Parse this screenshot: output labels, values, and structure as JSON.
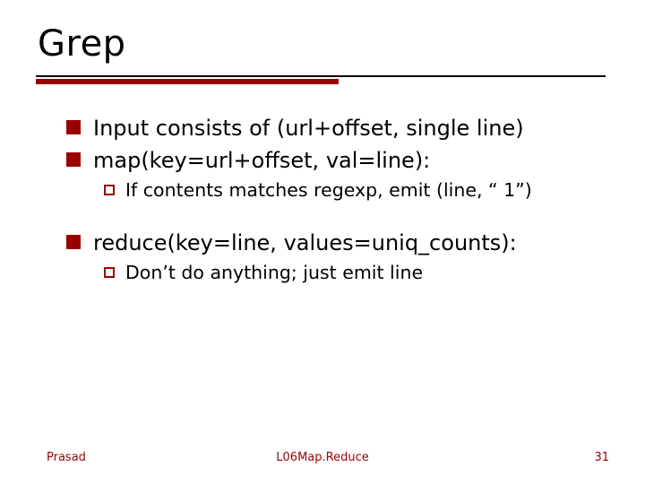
{
  "title": "Grep",
  "bullets": {
    "b1": "Input consists of (url+offset, single line)",
    "b2": "map(key=url+offset, val=line):",
    "b2a": "If contents matches regexp, emit (line, “ 1”)",
    "b3": "reduce(key=line, values=uniq_counts):",
    "b3a": "Don’t do anything; just emit line"
  },
  "footer": {
    "author": "Prasad",
    "deck": "L06Map.Reduce",
    "pageno": "31"
  }
}
